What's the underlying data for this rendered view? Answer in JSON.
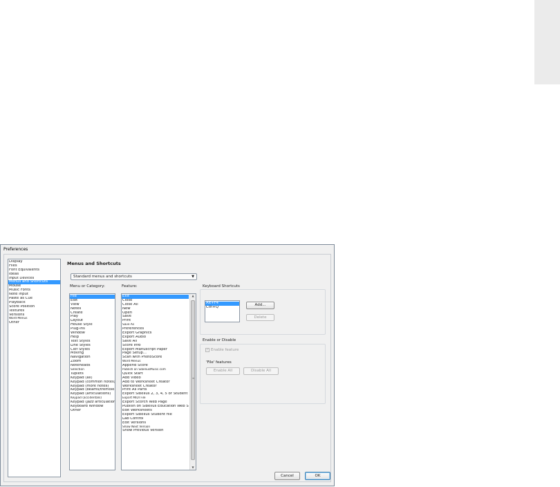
{
  "dialog": {
    "title": "Preferences",
    "categories": [
      "Display",
      "Files",
      "Font Equivalents",
      "Ideas",
      "Input Devices",
      "Menus and Shortcuts",
      "Mouse",
      "Music Fonts",
      "Note Input",
      "Paste as Cue",
      "Playback",
      "Score Position",
      "Textures",
      "Versions",
      "Word Menus",
      "Other"
    ],
    "selected_category": 5
  },
  "panel": {
    "heading": "Menus and Shortcuts",
    "preset_value": "Standard menus and shortcuts",
    "menu_label": "Menu or Category:",
    "feature_label": "Feature:",
    "menus": [
      "File",
      "Edit",
      "View",
      "Notes",
      "Create",
      "Play",
      "Layout",
      "House Style",
      "Plug-ins",
      "Window",
      "Help",
      "Text Styles",
      "Line Styles",
      "Clef Styles",
      "Moving",
      "Navigation",
      "Zoom",
      "Noteheads",
      "Selection",
      "Tuplets",
      "Keypad (all)",
      "Keypad (common notes)",
      "Keypad (more notes)",
      "Keypad (beams/tremolo",
      "Keypad (articulations)",
      "Keypad (accidentals)",
      "Keypad (jazz articulatior",
      "Keyboard Window",
      "Other"
    ],
    "selected_menu": 0,
    "features": [
      "Exit",
      "Close",
      "Close All",
      "New",
      "Open",
      "Save",
      "Print",
      "Save As",
      "Preferences",
      "Export Graphics",
      "Export Audio",
      "Save All",
      "Score Info",
      "Export Manuscript Paper",
      "Page Setup...",
      "Scan with PhotoScore",
      "Word Menus",
      "Append Score",
      "Publish on SibeliusMusic.com",
      "Quick Start",
      "Add Video",
      "Add to Worksheet Creator",
      "Worksheet Creator",
      "Print All Parts",
      "Export Sibelius 2, 3, 4, 5 or Student",
      "Export MIDI File",
      "Export Scorch Web Page",
      "Publish on Sibelius Education Web Si",
      "Edit Worksheets",
      "Export Sibelius Student file",
      "Lab Control",
      "Edit Versions",
      "Show Next Version",
      "Show Previous Version"
    ],
    "selected_feature": 0
  },
  "shortcuts": {
    "group_label": "Keyboard Shortcuts",
    "items": [
      "Alt+F4",
      "Ctrl+Q"
    ],
    "selected": 0,
    "add_label": "Add...",
    "delete_label": "Delete"
  },
  "enable": {
    "group_label": "Enable or Disable",
    "checkbox_label": "Enable feature",
    "features_label": "'File' features",
    "enable_all_label": "Enable All",
    "disable_all_label": "Disable All"
  },
  "footer": {
    "cancel_label": "Cancel",
    "ok_label": "OK"
  },
  "colors": {
    "selection": "#3399ff",
    "dialog_bg": "#f0f0f0"
  }
}
